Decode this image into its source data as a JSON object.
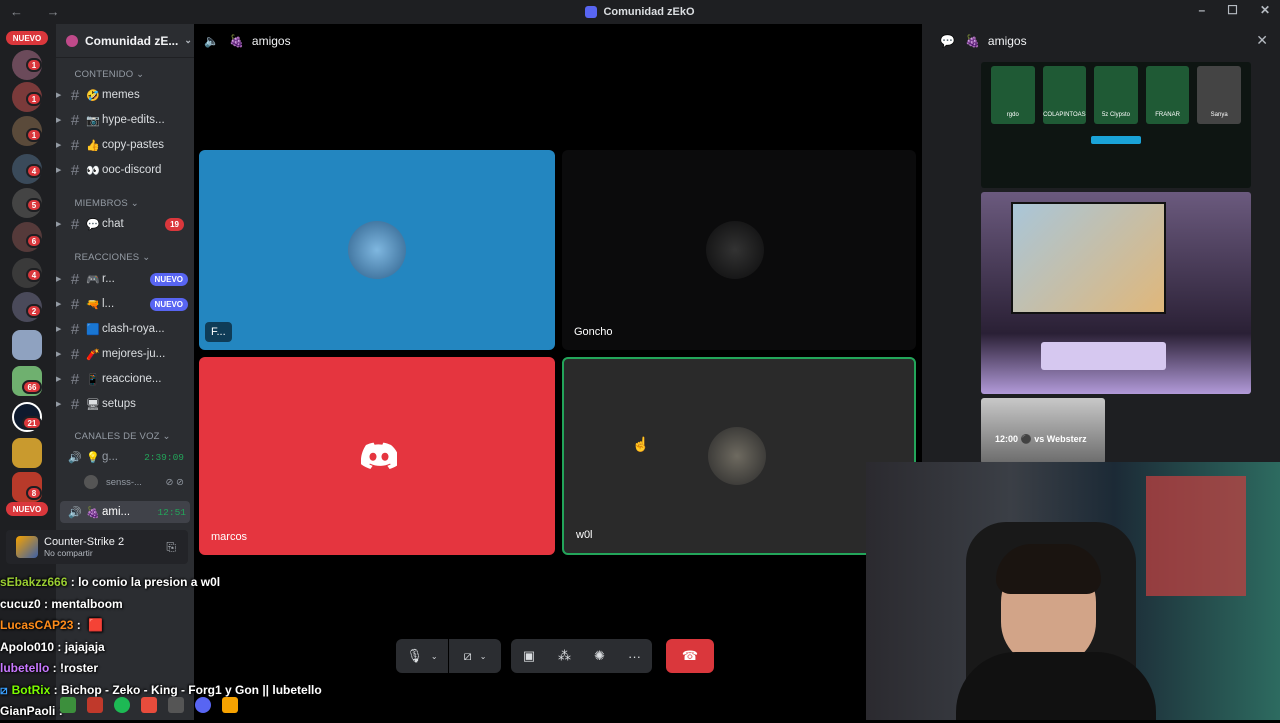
{
  "window": {
    "title": "Comunidad zEkO",
    "nav": "← →",
    "buttons": [
      "–",
      "☐",
      "✕"
    ]
  },
  "guilds": {
    "top_badge": "NUEVO",
    "bottom_badge": "NUEVO",
    "counts": [
      "1",
      "1",
      "1",
      "4",
      "5",
      "6",
      "4",
      "2",
      "66",
      "21",
      "8"
    ]
  },
  "server": {
    "name": "Comunidad zE...",
    "categories": {
      "contenido": "CONTENIDO",
      "miembros": "MIEMBROS",
      "reacciones": "REACCIONES",
      "voz": "CANALES DE VOZ"
    },
    "channels": [
      {
        "label": "memes",
        "emoji": "🤣"
      },
      {
        "label": "hype-edits...",
        "emoji": "📷"
      },
      {
        "label": "copy-pastes",
        "emoji": "👍"
      },
      {
        "label": "ooc-discord",
        "emoji": "👀"
      },
      {
        "label": "chat",
        "emoji": "💬",
        "count": "19"
      },
      {
        "label": "r...",
        "emoji": "🎮",
        "tag": "NUEVO"
      },
      {
        "label": "l...",
        "emoji": "🔫",
        "tag": "NUEVO"
      },
      {
        "label": "clash-roya...",
        "emoji": "🟦"
      },
      {
        "label": "mejores-ju...",
        "emoji": "🧨"
      },
      {
        "label": "reaccione...",
        "emoji": "📱"
      },
      {
        "label": "setups",
        "emoji": "🖥"
      }
    ],
    "voice": [
      {
        "label": "g...",
        "time": "2:39:09"
      },
      {
        "label": "senss-...",
        "time": ""
      },
      {
        "label": "ami...",
        "time": "12:51"
      }
    ]
  },
  "activity": {
    "game": "Counter-Strike 2",
    "status": "No compartir"
  },
  "stage": {
    "channel": "amigos",
    "tiles": [
      {
        "name": "F...",
        "bg": "#2386c0"
      },
      {
        "name": "Goncho",
        "bg": "#0b0b0c"
      },
      {
        "name": "marcos",
        "bg": "#e5353f"
      },
      {
        "name": "w0l",
        "bg": "#2a2a2a"
      }
    ]
  },
  "side_panel": {
    "channel": "amigos",
    "card_labels": [
      "rgdo",
      "COLAPINTOAS",
      "5z Clypsto",
      "FRANAR",
      "Sanya"
    ],
    "thumb_label": "12:00 ⚫ vs Websterz"
  },
  "chat_overlay": [
    {
      "user": "sEbakzz666",
      "color": "#9acd32",
      "msg": "lo comio la presion a w0l"
    },
    {
      "user": "cucuz0",
      "color": "#ffffff",
      "msg": "mentalboom"
    },
    {
      "user": "LucasCAP23",
      "color": "#ff8c1a",
      "msg": ""
    },
    {
      "user": "Apolo010",
      "color": "#ffffff",
      "msg": "jajajaja"
    },
    {
      "user": "lubetello",
      "color": "#c878ff",
      "msg": "!roster"
    },
    {
      "user": "BotRix",
      "color": "#7cfc00",
      "msg": "Bichop - Zeko - King - Forg1 y Gon || lubetello"
    },
    {
      "user": "GianPaoli",
      "color": "#ffffff",
      "msg": ""
    }
  ],
  "colors": {
    "blurple": "#5865f2",
    "green": "#23a55a",
    "red": "#da373c"
  }
}
